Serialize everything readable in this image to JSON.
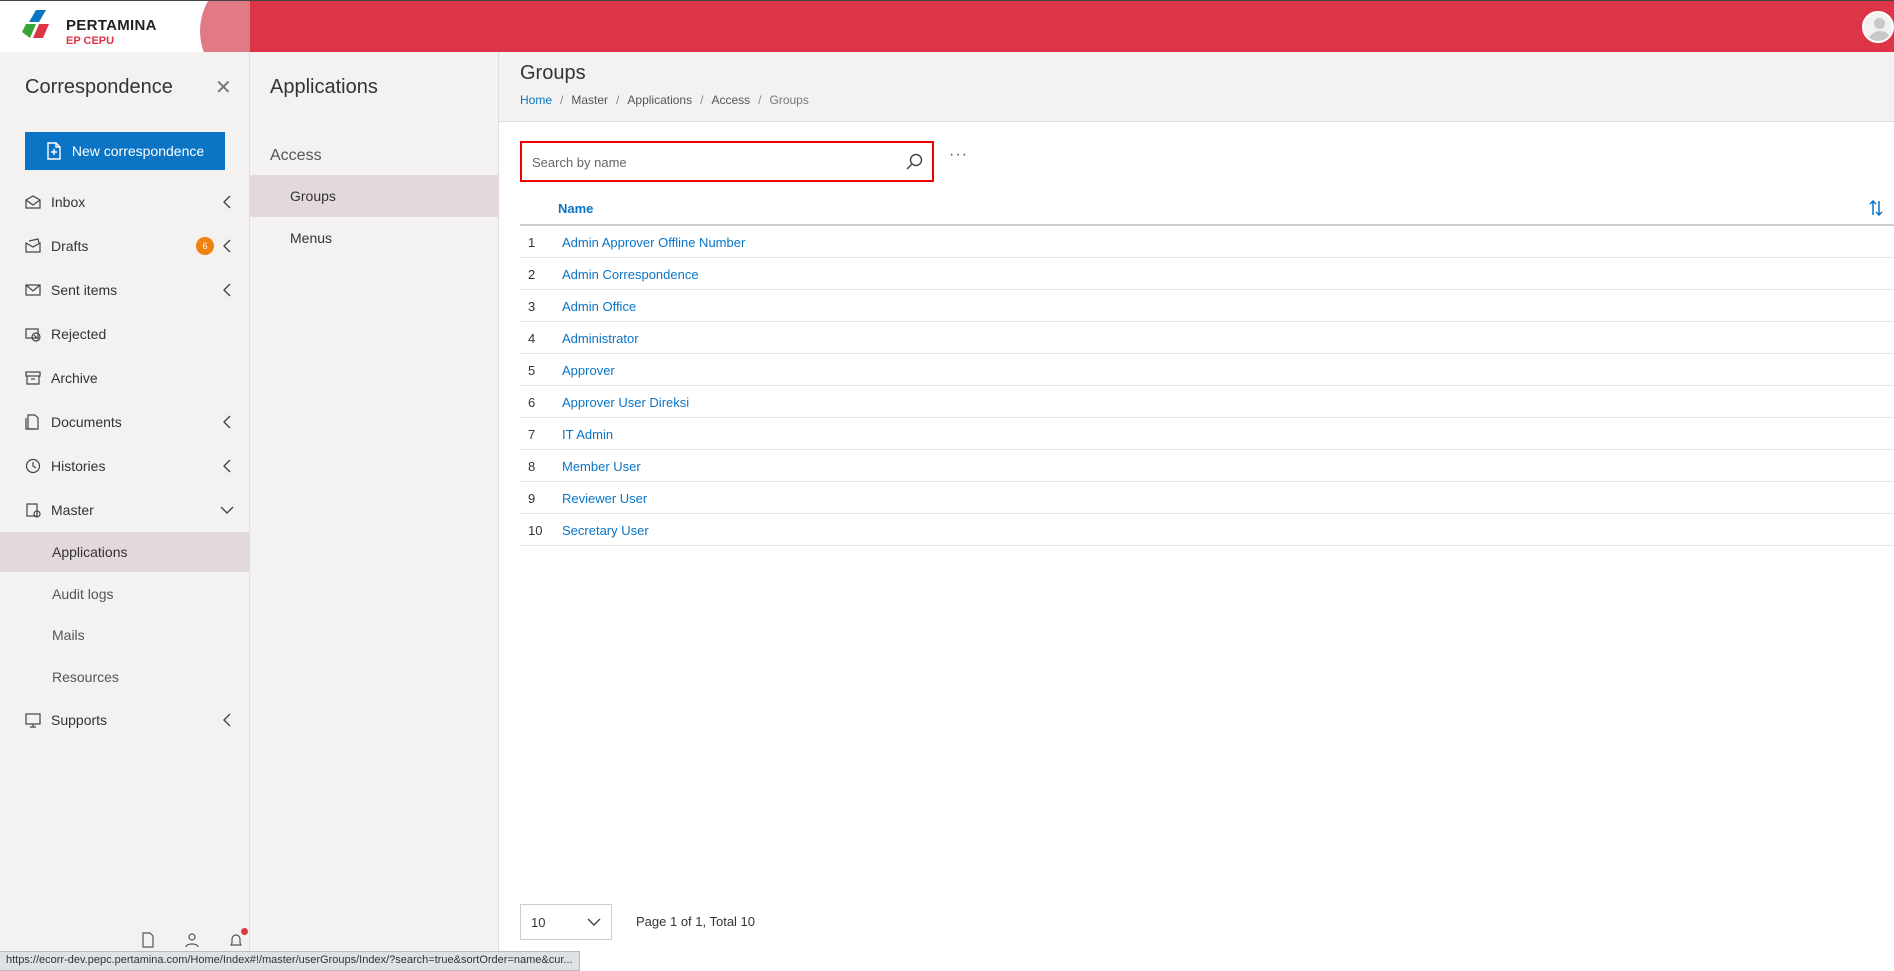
{
  "brand": {
    "name": "PERTAMINA",
    "sub": "EP CEPU"
  },
  "sidebar": {
    "title": "Correspondence",
    "new_button": "New correspondence",
    "items": [
      {
        "label": "Inbox",
        "icon": "inbox-icon"
      },
      {
        "label": "Drafts",
        "icon": "drafts-icon",
        "badge": "6"
      },
      {
        "label": "Sent items",
        "icon": "sent-icon"
      },
      {
        "label": "Rejected",
        "icon": "rejected-icon"
      },
      {
        "label": "Archive",
        "icon": "archive-icon"
      },
      {
        "label": "Documents",
        "icon": "documents-icon"
      },
      {
        "label": "Histories",
        "icon": "histories-icon"
      },
      {
        "label": "Master",
        "icon": "master-icon"
      }
    ],
    "master_sub": [
      "Applications",
      "Audit logs",
      "Mails",
      "Resources"
    ],
    "supports": "Supports"
  },
  "midpanel": {
    "title": "Applications",
    "section": "Access",
    "items": [
      "Groups",
      "Menus"
    ]
  },
  "main": {
    "title": "Groups",
    "breadcrumb": [
      "Home",
      "Master",
      "Applications",
      "Access",
      "Groups"
    ],
    "search_placeholder": "Search by name",
    "more": "···",
    "column_name": "Name",
    "rows": [
      {
        "num": "1",
        "name": "Admin Approver Offline Number"
      },
      {
        "num": "2",
        "name": "Admin Correspondence"
      },
      {
        "num": "3",
        "name": "Admin Office"
      },
      {
        "num": "4",
        "name": "Administrator"
      },
      {
        "num": "5",
        "name": "Approver"
      },
      {
        "num": "6",
        "name": "Approver User Direksi"
      },
      {
        "num": "7",
        "name": "IT Admin"
      },
      {
        "num": "8",
        "name": "Member User"
      },
      {
        "num": "9",
        "name": "Reviewer User"
      },
      {
        "num": "10",
        "name": "Secretary User"
      }
    ],
    "page_size": "10",
    "page_info": "Page 1 of 1, Total 10"
  },
  "status_url": "https://ecorr-dev.pepc.pertamina.com/Home/Index#!/master/userGroups/Index/?search=true&sortOrder=name&cur...",
  "colors": {
    "accent": "#dc3545",
    "primary": "#0b74c4",
    "badge": "#f0820f"
  }
}
